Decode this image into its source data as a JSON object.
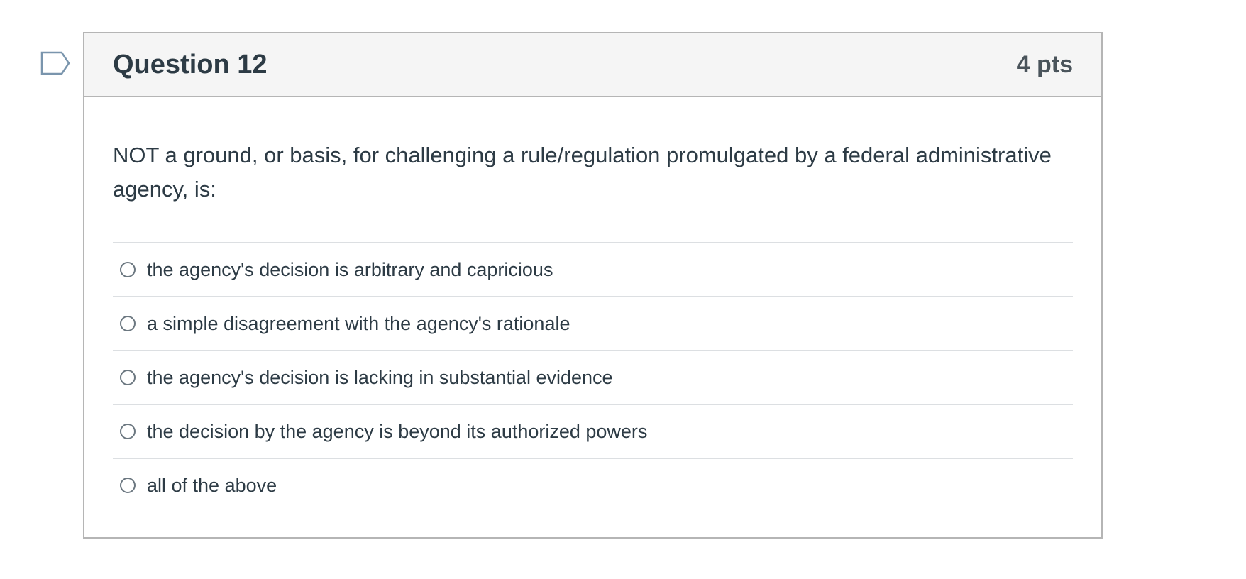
{
  "question": {
    "title": "Question 12",
    "points": "4 pts",
    "text": "NOT a ground, or basis, for challenging a rule/regulation promulgated by a federal administrative agency, is:",
    "answers": [
      {
        "label": "the agency's decision is arbitrary and capricious",
        "selected": false
      },
      {
        "label": "a simple disagreement with the agency's rationale",
        "selected": false
      },
      {
        "label": "the agency's decision is lacking in substantial evidence",
        "selected": false
      },
      {
        "label": "the decision by the agency is beyond its authorized powers",
        "selected": false
      },
      {
        "label": "all of the above",
        "selected": false
      }
    ]
  },
  "icons": {
    "flag": "flag-question-icon"
  },
  "colors": {
    "text": "#2d3b45",
    "header_bg": "#f5f5f5",
    "border": "#b5b5b5",
    "flag": "#7a95ad"
  }
}
